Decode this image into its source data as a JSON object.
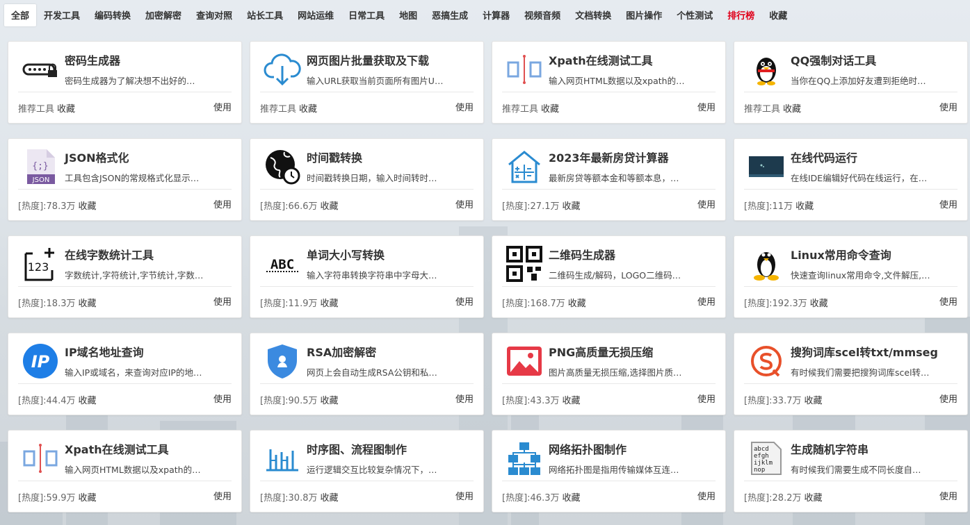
{
  "nav": [
    {
      "label": "全部",
      "active": true
    },
    {
      "label": "开发工具"
    },
    {
      "label": "编码转换"
    },
    {
      "label": "加密解密"
    },
    {
      "label": "查询对照"
    },
    {
      "label": "站长工具"
    },
    {
      "label": "网站运维"
    },
    {
      "label": "日常工具"
    },
    {
      "label": "地图"
    },
    {
      "label": "恶搞生成"
    },
    {
      "label": "计算器"
    },
    {
      "label": "视频音频"
    },
    {
      "label": "文档转换"
    },
    {
      "label": "图片操作"
    },
    {
      "label": "个性测试"
    },
    {
      "label": "排行榜",
      "hot": true
    },
    {
      "label": "收藏"
    }
  ],
  "cards": [
    {
      "icon": "password-icon",
      "title": "密码生成器",
      "desc": "密码生成器为了解决想不出好的…",
      "meta": "推荐工具",
      "fav": "收藏",
      "use": "使用"
    },
    {
      "icon": "cloud-download-icon",
      "title": "网页图片批量获取及下载",
      "desc": "输入URL获取当前页面所有图片U…",
      "meta": "推荐工具",
      "fav": "收藏",
      "use": "使用"
    },
    {
      "icon": "xpath-icon",
      "title": "Xpath在线测试工具",
      "desc": "输入网页HTML数据以及xpath的…",
      "meta": "推荐工具",
      "fav": "收藏",
      "use": "使用"
    },
    {
      "icon": "qq-penguin-icon",
      "title": "QQ强制对话工具",
      "desc": "当你在QQ上添加好友遭到拒绝时…",
      "meta": "推荐工具",
      "fav": "收藏",
      "use": "使用"
    },
    {
      "icon": "json-file-icon",
      "title": "JSON格式化",
      "desc": "工具包含JSON的常规格式化显示…",
      "meta": "[热度]:78.3万",
      "fav": "收藏",
      "use": "使用"
    },
    {
      "icon": "globe-clock-icon",
      "title": "时间戳转换",
      "desc": "时间戳转换日期，输入时间转时…",
      "meta": "[热度]:66.6万",
      "fav": "收藏",
      "use": "使用"
    },
    {
      "icon": "house-calculator-icon",
      "title": "2023年最新房贷计算器",
      "desc": "最新房贷等额本金和等额本息，…",
      "meta": "[热度]:27.1万",
      "fav": "收藏",
      "use": "使用"
    },
    {
      "icon": "code-terminal-icon",
      "title": "在线代码运行",
      "desc": "在线IDE编辑好代码在线运行，在…",
      "meta": "[热度]:11万",
      "fav": "收藏",
      "use": "使用"
    },
    {
      "icon": "word-count-icon",
      "title": "在线字数统计工具",
      "desc": "字数统计,字符统计,字节统计,字数…",
      "meta": "[热度]:18.3万",
      "fav": "收藏",
      "use": "使用"
    },
    {
      "icon": "abc-case-icon",
      "title": "单词大小写转换",
      "desc": "输入字符串转换字符串中字母大…",
      "meta": "[热度]:11.9万",
      "fav": "收藏",
      "use": "使用"
    },
    {
      "icon": "qrcode-icon",
      "title": "二维码生成器",
      "desc": "二维码生成/解码，LOGO二维码…",
      "meta": "[热度]:168.7万",
      "fav": "收藏",
      "use": "使用"
    },
    {
      "icon": "linux-penguin-icon",
      "title": "Linux常用命令查询",
      "desc": "快速查询linux常用命令,文件解压,…",
      "meta": "[热度]:192.3万",
      "fav": "收藏",
      "use": "使用"
    },
    {
      "icon": "ip-icon",
      "title": "IP域名地址查询",
      "desc": "输入IP或域名，来查询对应IP的地…",
      "meta": "[热度]:44.4万",
      "fav": "收藏",
      "use": "使用"
    },
    {
      "icon": "shield-icon",
      "title": "RSA加密解密",
      "desc": "网页上会自动生成RSA公钥和私…",
      "meta": "[热度]:90.5万",
      "fav": "收藏",
      "use": "使用"
    },
    {
      "icon": "image-icon",
      "title": "PNG高质量无损压缩",
      "desc": "图片高质量无损压缩,选择图片质…",
      "meta": "[热度]:43.3万",
      "fav": "收藏",
      "use": "使用"
    },
    {
      "icon": "sogou-icon",
      "title": "搜狗词库scel转txt/mmseg",
      "desc": "有时候我们需要把搜狗词库scel转…",
      "meta": "[热度]:33.7万",
      "fav": "收藏",
      "use": "使用"
    },
    {
      "icon": "xpath-icon",
      "title": "Xpath在线测试工具",
      "desc": "输入网页HTML数据以及xpath的…",
      "meta": "[热度]:59.9万",
      "fav": "收藏",
      "use": "使用"
    },
    {
      "icon": "sequence-diagram-icon",
      "title": "时序图、流程图制作",
      "desc": "运行逻辑交互比较复杂情况下，…",
      "meta": "[热度]:30.8万",
      "fav": "收藏",
      "use": "使用"
    },
    {
      "icon": "network-topology-icon",
      "title": "网络拓扑图制作",
      "desc": "网络拓扑图是指用传输媒体互连…",
      "meta": "[热度]:46.3万",
      "fav": "收藏",
      "use": "使用"
    },
    {
      "icon": "random-string-icon",
      "title": "生成随机字符串",
      "desc": "有时候我们需要生成不同长度自…",
      "meta": "[热度]:28.2万",
      "fav": "收藏",
      "use": "使用"
    }
  ]
}
